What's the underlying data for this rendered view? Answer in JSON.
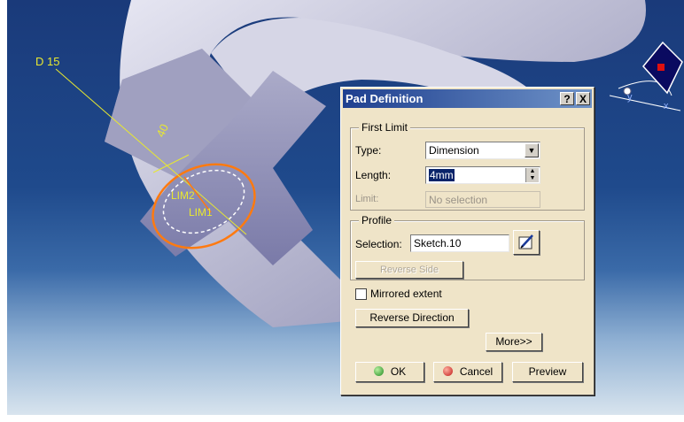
{
  "viewport": {
    "dimension_label": "D 15",
    "angle_label": "40",
    "lim2_label": "LIM2",
    "lim1_label": "LIM1",
    "compass_x": "x",
    "compass_y": "y"
  },
  "dialog": {
    "title": "Pad Definition",
    "help_button": "?",
    "close_button": "X",
    "first_limit": {
      "group_label": "First Limit",
      "type_label": "Type:",
      "type_value": "Dimension",
      "length_label": "Length:",
      "length_value": "4mm",
      "limit_label": "Limit:",
      "limit_value": "No selection"
    },
    "profile": {
      "group_label": "Profile",
      "selection_label": "Selection:",
      "selection_value": "Sketch.10",
      "reverse_side": "Reverse Side"
    },
    "mirrored_extent": "Mirrored extent",
    "reverse_direction": "Reverse Direction",
    "more": "More>>",
    "ok": "OK",
    "cancel": "Cancel",
    "preview": "Preview"
  },
  "colors": {
    "annotation": "#e8e830",
    "sketch_orange": "#ff7a10",
    "title_start": "#1e3f8f",
    "dialog_bg": "#efe4c8"
  }
}
